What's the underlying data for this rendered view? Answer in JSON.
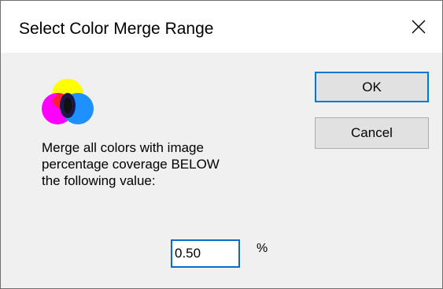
{
  "window": {
    "title": "Select Color Merge Range",
    "close_icon": "close-icon"
  },
  "logo": {
    "icon": "color-merge-icon",
    "colors": {
      "yellow": "#ffff00",
      "magenta": "#ff00ff",
      "cyan": "#00a8ff",
      "red": "#ff0000",
      "green": "#00b050",
      "blue": "#3355cc",
      "center": "#222222"
    }
  },
  "message": {
    "line1": "Merge all colors with image",
    "line2": "percentage coverage BELOW",
    "line3": "the following value:"
  },
  "value_field": {
    "value": "0.50",
    "unit": "%"
  },
  "buttons": {
    "ok_label": "OK",
    "cancel_label": "Cancel"
  },
  "colors": {
    "accent": "#0078d7",
    "client_bg": "#f0f0f0",
    "titlebar_bg": "#ffffff"
  }
}
